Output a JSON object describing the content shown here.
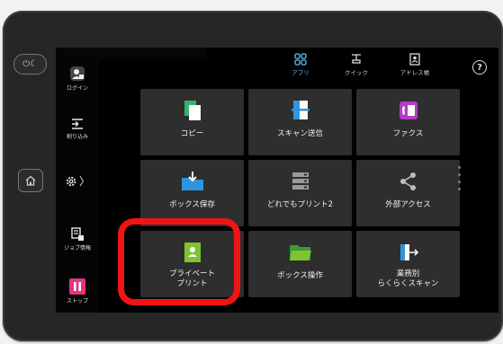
{
  "hardware": {
    "power_icon": "power-sleep-icon",
    "home_icon": "home-icon"
  },
  "sidebar": {
    "items": [
      {
        "label": "ログイン",
        "icon": "user-lock-icon"
      },
      {
        "label": "割り込み",
        "icon": "interrupt-icon"
      },
      {
        "label": "",
        "icon": "gear-icon"
      },
      {
        "label": "ジョブ情報",
        "icon": "job-info-icon"
      },
      {
        "label": "ストップ",
        "icon": "stop-icon"
      }
    ],
    "expand_glyph": "〉"
  },
  "topnav": {
    "items": [
      {
        "label": "アプリ",
        "icon": "apps-grid-icon",
        "active": true
      },
      {
        "label": "クイック",
        "icon": "quick-icon",
        "active": false
      },
      {
        "label": "アドレス帳",
        "icon": "address-book-icon",
        "active": false
      }
    ],
    "help_glyph": "?"
  },
  "tiles": [
    {
      "label": "コピー",
      "icon": "copy-icon"
    },
    {
      "label": "スキャン送信",
      "icon": "scan-send-icon"
    },
    {
      "label": "ファクス",
      "icon": "fax-icon"
    },
    {
      "label": "ボックス保存",
      "icon": "box-save-icon"
    },
    {
      "label": "どれでもプリント2",
      "icon": "any-print-icon"
    },
    {
      "label": "外部アクセス",
      "icon": "share-icon"
    },
    {
      "label": "プライベート\nプリント",
      "icon": "private-print-icon"
    },
    {
      "label": "ボックス操作",
      "icon": "box-operate-icon"
    },
    {
      "label": "業務別\nらくらくスキャン",
      "icon": "easy-scan-icon"
    }
  ],
  "colors": {
    "highlight": "#f01414",
    "active_nav": "#55bfff",
    "tile_bg": "#2e2e2e"
  }
}
